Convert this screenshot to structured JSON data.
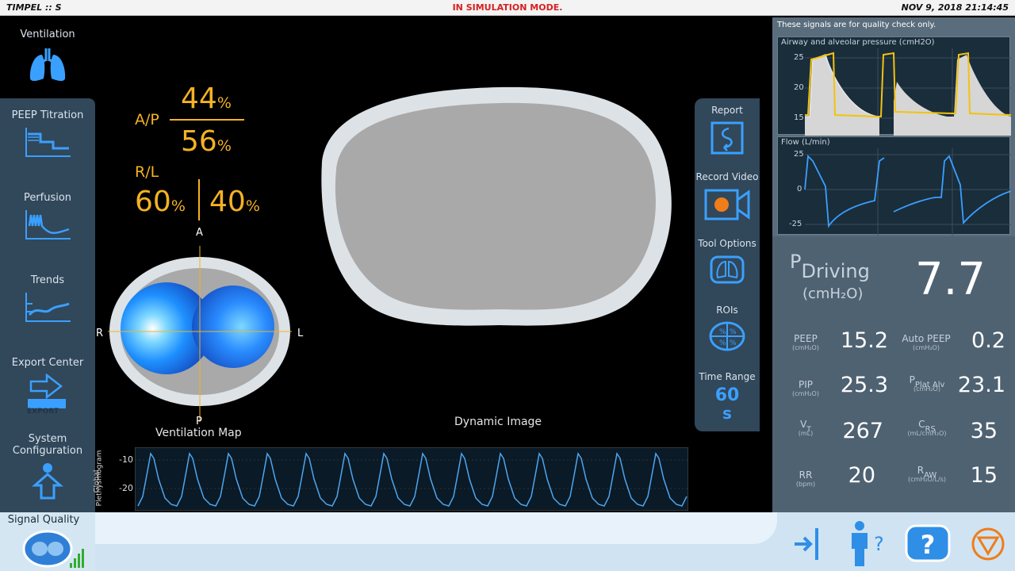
{
  "header": {
    "title": "TIMPEL :: S",
    "mode": "IN SIMULATION MODE.",
    "datetime": "NOV 9, 2018 21:14:45"
  },
  "nav": {
    "ventilation": "Ventilation",
    "peep_titration": "PEEP Titration",
    "perfusion": "Perfusion",
    "trends": "Trends",
    "export_center": "Export Center",
    "export_badge": "EXPORT",
    "system_configuration_1": "System",
    "system_configuration_2": "Configuration",
    "signal_quality": "Signal Quality"
  },
  "distribution": {
    "ap_label": "A/P",
    "anterior": "44",
    "posterior": "56",
    "rl_label": "R/L",
    "right": "60",
    "left": "40",
    "pct": "%"
  },
  "map": {
    "anterior": "A",
    "posterior": "P",
    "right": "R",
    "left": "L",
    "caption": "Ventilation Map",
    "dynamic_caption": "Dynamic Image"
  },
  "pleth": {
    "ylabel_1": "Global",
    "ylabel_2": "Plethysmogram",
    "ticks": [
      "-10",
      "-20"
    ]
  },
  "tools": {
    "report": "Report",
    "record_video": "Record Video",
    "tool_options": "Tool Options",
    "rois": "ROIs",
    "time_range": "Time Range",
    "time_range_value": "60",
    "time_range_unit": "s"
  },
  "signals": {
    "note": "These signals are for quality check only.",
    "pressure_title": "Airway and alveolar pressure (cmH2O)",
    "pressure_ticks": [
      "25",
      "20",
      "15"
    ],
    "flow_title": "Flow (L/min)",
    "flow_ticks": [
      "25",
      "0",
      "-25"
    ]
  },
  "values": {
    "driving_p": "P",
    "driving_label": "Driving",
    "driving_unit": "(cmH₂O)",
    "driving_value": "7.7",
    "peep_label": "PEEP",
    "peep_unit": "(cmH₂O)",
    "peep_value": "15.2",
    "autopeep_label": "Auto PEEP",
    "autopeep_unit": "(cmH₂O)",
    "autopeep_value": "0.2",
    "pip_label": "PIP",
    "pip_unit": "(cmH₂O)",
    "pip_value": "25.3",
    "pplat_p": "P",
    "pplat_label": "Plat Alv",
    "pplat_unit": "(cmH₂O)",
    "pplat_value": "23.1",
    "vt_v": "V",
    "vt_sub": "T",
    "vt_unit": "(mL)",
    "vt_value": "267",
    "crs_c": "C",
    "crs_sub": "RS",
    "crs_unit": "(mL/cmH₂O)",
    "crs_value": "35",
    "rr_label": "RR",
    "rr_unit": "(bpm)",
    "rr_value": "20",
    "raw_r": "R",
    "raw_sub": "AW",
    "raw_unit": "(cmH₂O/L/s)",
    "raw_value": "15"
  },
  "colors": {
    "accent_orange": "#f4b224",
    "accent_blue": "#3aa0ff",
    "panel": "#31475a",
    "stop_orange": "#ef7d1a"
  },
  "icons": [
    "lungs-icon",
    "peep-titration-icon",
    "perfusion-icon",
    "trends-icon",
    "export-icon",
    "patient-config-icon",
    "signal-quality-icon",
    "report-icon",
    "record-video-icon",
    "tool-options-icon",
    "rois-icon",
    "exit-icon",
    "patient-help-icon",
    "help-icon",
    "stop-icon"
  ]
}
